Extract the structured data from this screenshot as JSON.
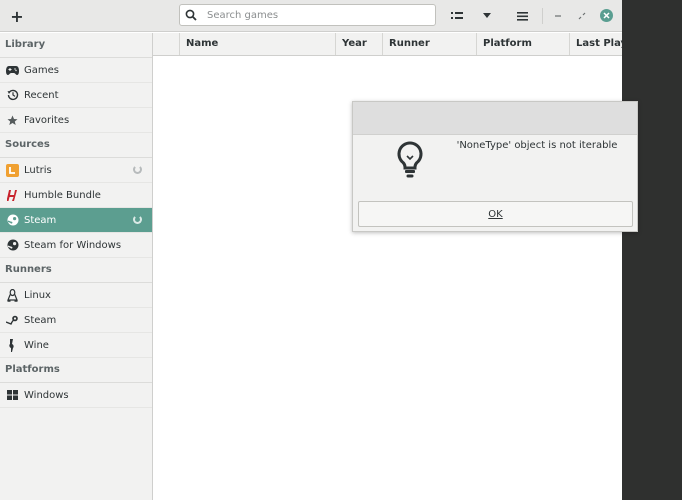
{
  "header": {
    "add_label": "+",
    "search_placeholder": "Search games"
  },
  "sidebar": {
    "sections": [
      {
        "title": "Library",
        "items": [
          {
            "label": "Games",
            "icon": "gamepad-icon"
          },
          {
            "label": "Recent",
            "icon": "history-icon"
          },
          {
            "label": "Favorites",
            "icon": "star-icon"
          }
        ]
      },
      {
        "title": "Sources",
        "items": [
          {
            "label": "Lutris",
            "icon": "lutris-icon",
            "loading": true
          },
          {
            "label": "Humble Bundle",
            "icon": "humble-icon"
          },
          {
            "label": "Steam",
            "icon": "steam-icon",
            "loading": true,
            "active": true
          },
          {
            "label": "Steam for Windows",
            "icon": "steam-icon"
          }
        ]
      },
      {
        "title": "Runners",
        "items": [
          {
            "label": "Linux",
            "icon": "linux-icon"
          },
          {
            "label": "Steam",
            "icon": "steam-runner-icon"
          },
          {
            "label": "Wine",
            "icon": "wine-icon"
          }
        ]
      },
      {
        "title": "Platforms",
        "items": [
          {
            "label": "Windows",
            "icon": "windows-icon"
          }
        ]
      }
    ]
  },
  "columns": [
    "Name",
    "Year",
    "Runner",
    "Platform",
    "Last Played"
  ],
  "dialog": {
    "message": "'NoneType' object is not iterable",
    "ok_label": "OK"
  },
  "colors": {
    "accent": "#5c9e90",
    "sidebar_bg": "#f2f2f1",
    "desktop_bg": "#2f302f"
  }
}
